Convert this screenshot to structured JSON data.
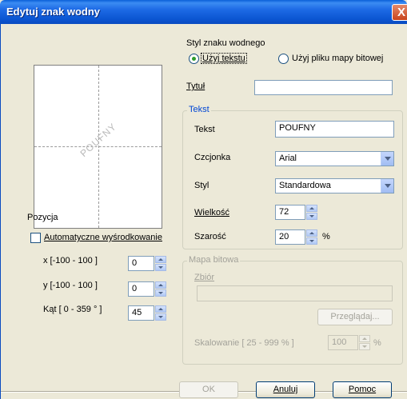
{
  "window": {
    "title": "Edytuj znak wodny",
    "close": "X"
  },
  "preview": {
    "watermark_text": "POUFNY"
  },
  "position": {
    "heading": "Pozycja",
    "auto_center_label": "Automatyczne wyśrodkowanie",
    "auto_center_checked": false,
    "x_label": "x [-100 - 100 ]",
    "x_value": "0",
    "y_label": "y [-100 - 100 ]",
    "y_value": "0",
    "angle_label": "Kąt [ 0 - 359 ° ]",
    "angle_value": "45"
  },
  "style": {
    "heading": "Styl znaku wodnego",
    "use_text_label": "Użyj tekstu",
    "use_bitmap_label": "Użyj pliku mapy bitowej",
    "selected": "use_text"
  },
  "title_field": {
    "label": "Tytuł",
    "value": ""
  },
  "text_group": {
    "legend": "Tekst",
    "text_label": "Tekst",
    "text_value": "POUFNY",
    "font_label": "Czcjonka",
    "font_value": "Arial",
    "style_label": "Styl",
    "style_value": "Standardowa",
    "size_label": "Wielkość",
    "size_value": "72",
    "gray_label": "Szarość",
    "gray_value": "20",
    "gray_unit": "%"
  },
  "bitmap_group": {
    "legend": "Mapa bitowa",
    "file_label": "Zbiór",
    "file_value": "",
    "browse_label": "Przeglądaj...",
    "scale_label": "Skalowanie [ 25 - 999 % ]",
    "scale_value": "100",
    "scale_unit": "%"
  },
  "buttons": {
    "ok": "OK",
    "cancel": "Anuluj",
    "help": "Pomoc"
  },
  "colors": {
    "titlebar": "#0a5fd8",
    "face": "#ece9d8",
    "group_label": "#0046d5",
    "radio_dot": "#2d9b2d"
  }
}
